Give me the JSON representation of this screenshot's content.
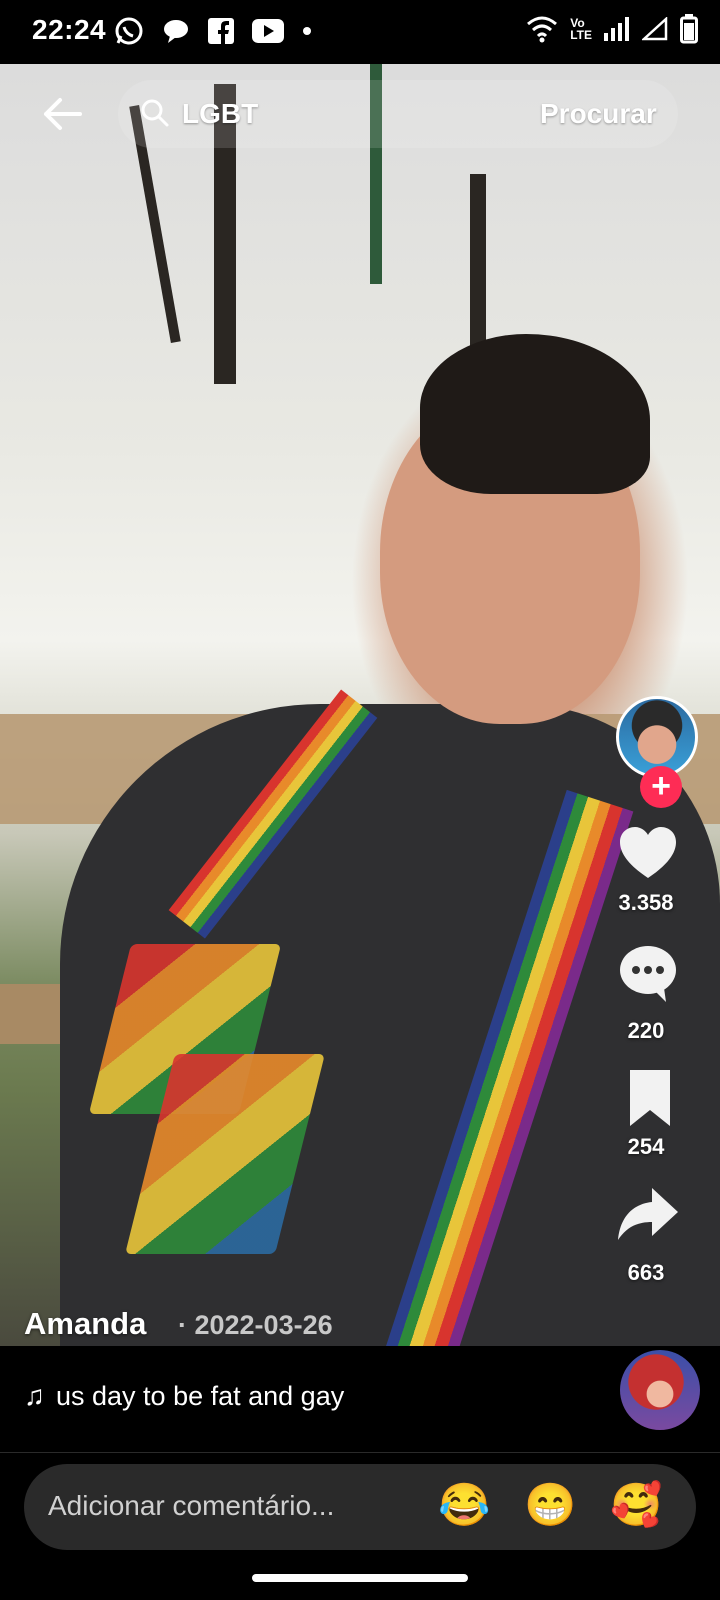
{
  "status_bar": {
    "time": "22:24",
    "notification_icons": [
      "whatsapp-icon",
      "chat-bubble-icon",
      "facebook-icon",
      "youtube-icon",
      "dot-icon"
    ],
    "system_icons": [
      "wifi-icon",
      "volte-icon",
      "signal-icon",
      "signal-outline-icon",
      "battery-icon"
    ],
    "volte_label_top": "Vo",
    "volte_label_bottom": "LTE"
  },
  "header": {
    "search_query": "LGBT",
    "search_button_label": "Procurar"
  },
  "video": {
    "author": "Amanda",
    "date": "· 2022-03-26",
    "caption": "us day to be fat and gay",
    "music_note": "♫"
  },
  "actions": {
    "likes": "3.358",
    "comments": "220",
    "saves": "254",
    "shares": "663",
    "follow_symbol": "+"
  },
  "comment_bar": {
    "placeholder": "Adicionar comentário...",
    "emojis": [
      "😂",
      "😁",
      "🥰"
    ]
  },
  "colors": {
    "follow_red": "#fe2c55",
    "panel_bg": "#000000",
    "input_bg": "#2a2a2a"
  }
}
